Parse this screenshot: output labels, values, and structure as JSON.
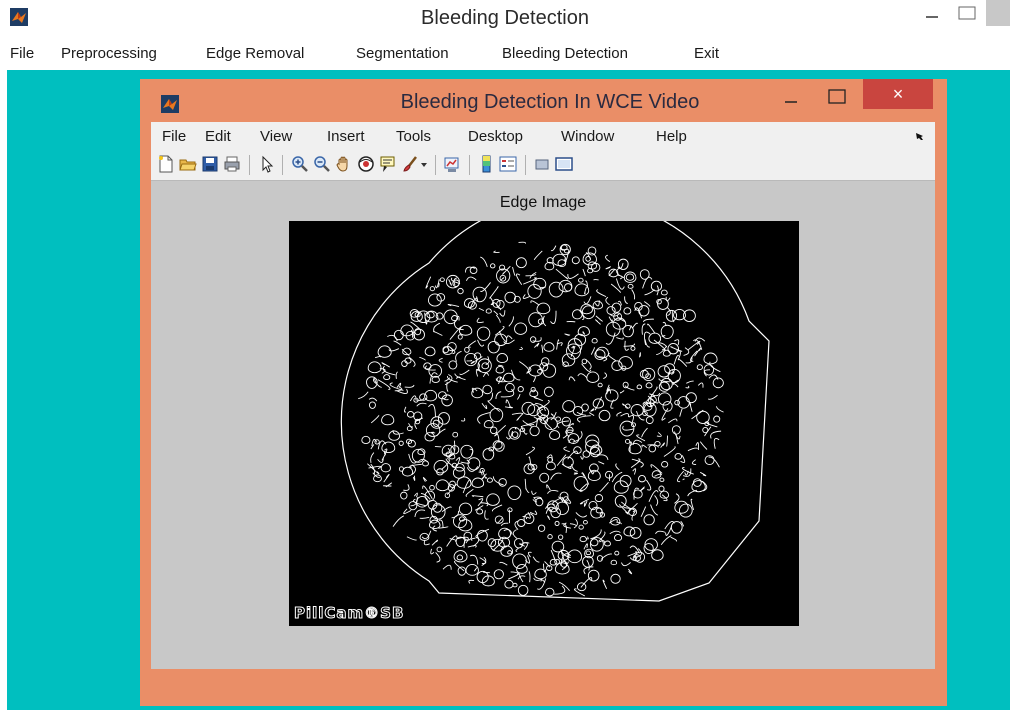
{
  "outer_window": {
    "title": "Bleeding Detection",
    "menu": [
      {
        "label": "File"
      },
      {
        "label": "Preprocessing"
      },
      {
        "label": "Edge Removal"
      },
      {
        "label": "Segmentation"
      },
      {
        "label": "Bleeding Detection"
      },
      {
        "label": "Exit"
      }
    ]
  },
  "figure_window": {
    "title": "Bleeding Detection In WCE Video",
    "close_label": "×",
    "menu": [
      {
        "label": "File"
      },
      {
        "label": "Edit"
      },
      {
        "label": "View"
      },
      {
        "label": "Insert"
      },
      {
        "label": "Tools"
      },
      {
        "label": "Desktop"
      },
      {
        "label": "Window"
      },
      {
        "label": "Help"
      }
    ],
    "toolbar_icons": [
      "new-figure-icon",
      "open-file-icon",
      "save-icon",
      "print-icon",
      "edit-plot-arrow-icon",
      "zoom-in-icon",
      "zoom-out-icon",
      "pan-hand-icon",
      "rotate-3d-icon",
      "data-cursor-icon",
      "brush-icon",
      "link-plot-icon",
      "insert-colorbar-icon",
      "insert-legend-icon",
      "hide-plot-tools-icon",
      "show-plot-tools-icon"
    ],
    "axes_title": "Edge Image",
    "watermark": "PillCam®SB"
  },
  "colors": {
    "desktop": "#00bfbf",
    "figure_frame": "#ea8e67",
    "close_button": "#c9453f",
    "canvas": "#c8c8c8"
  }
}
